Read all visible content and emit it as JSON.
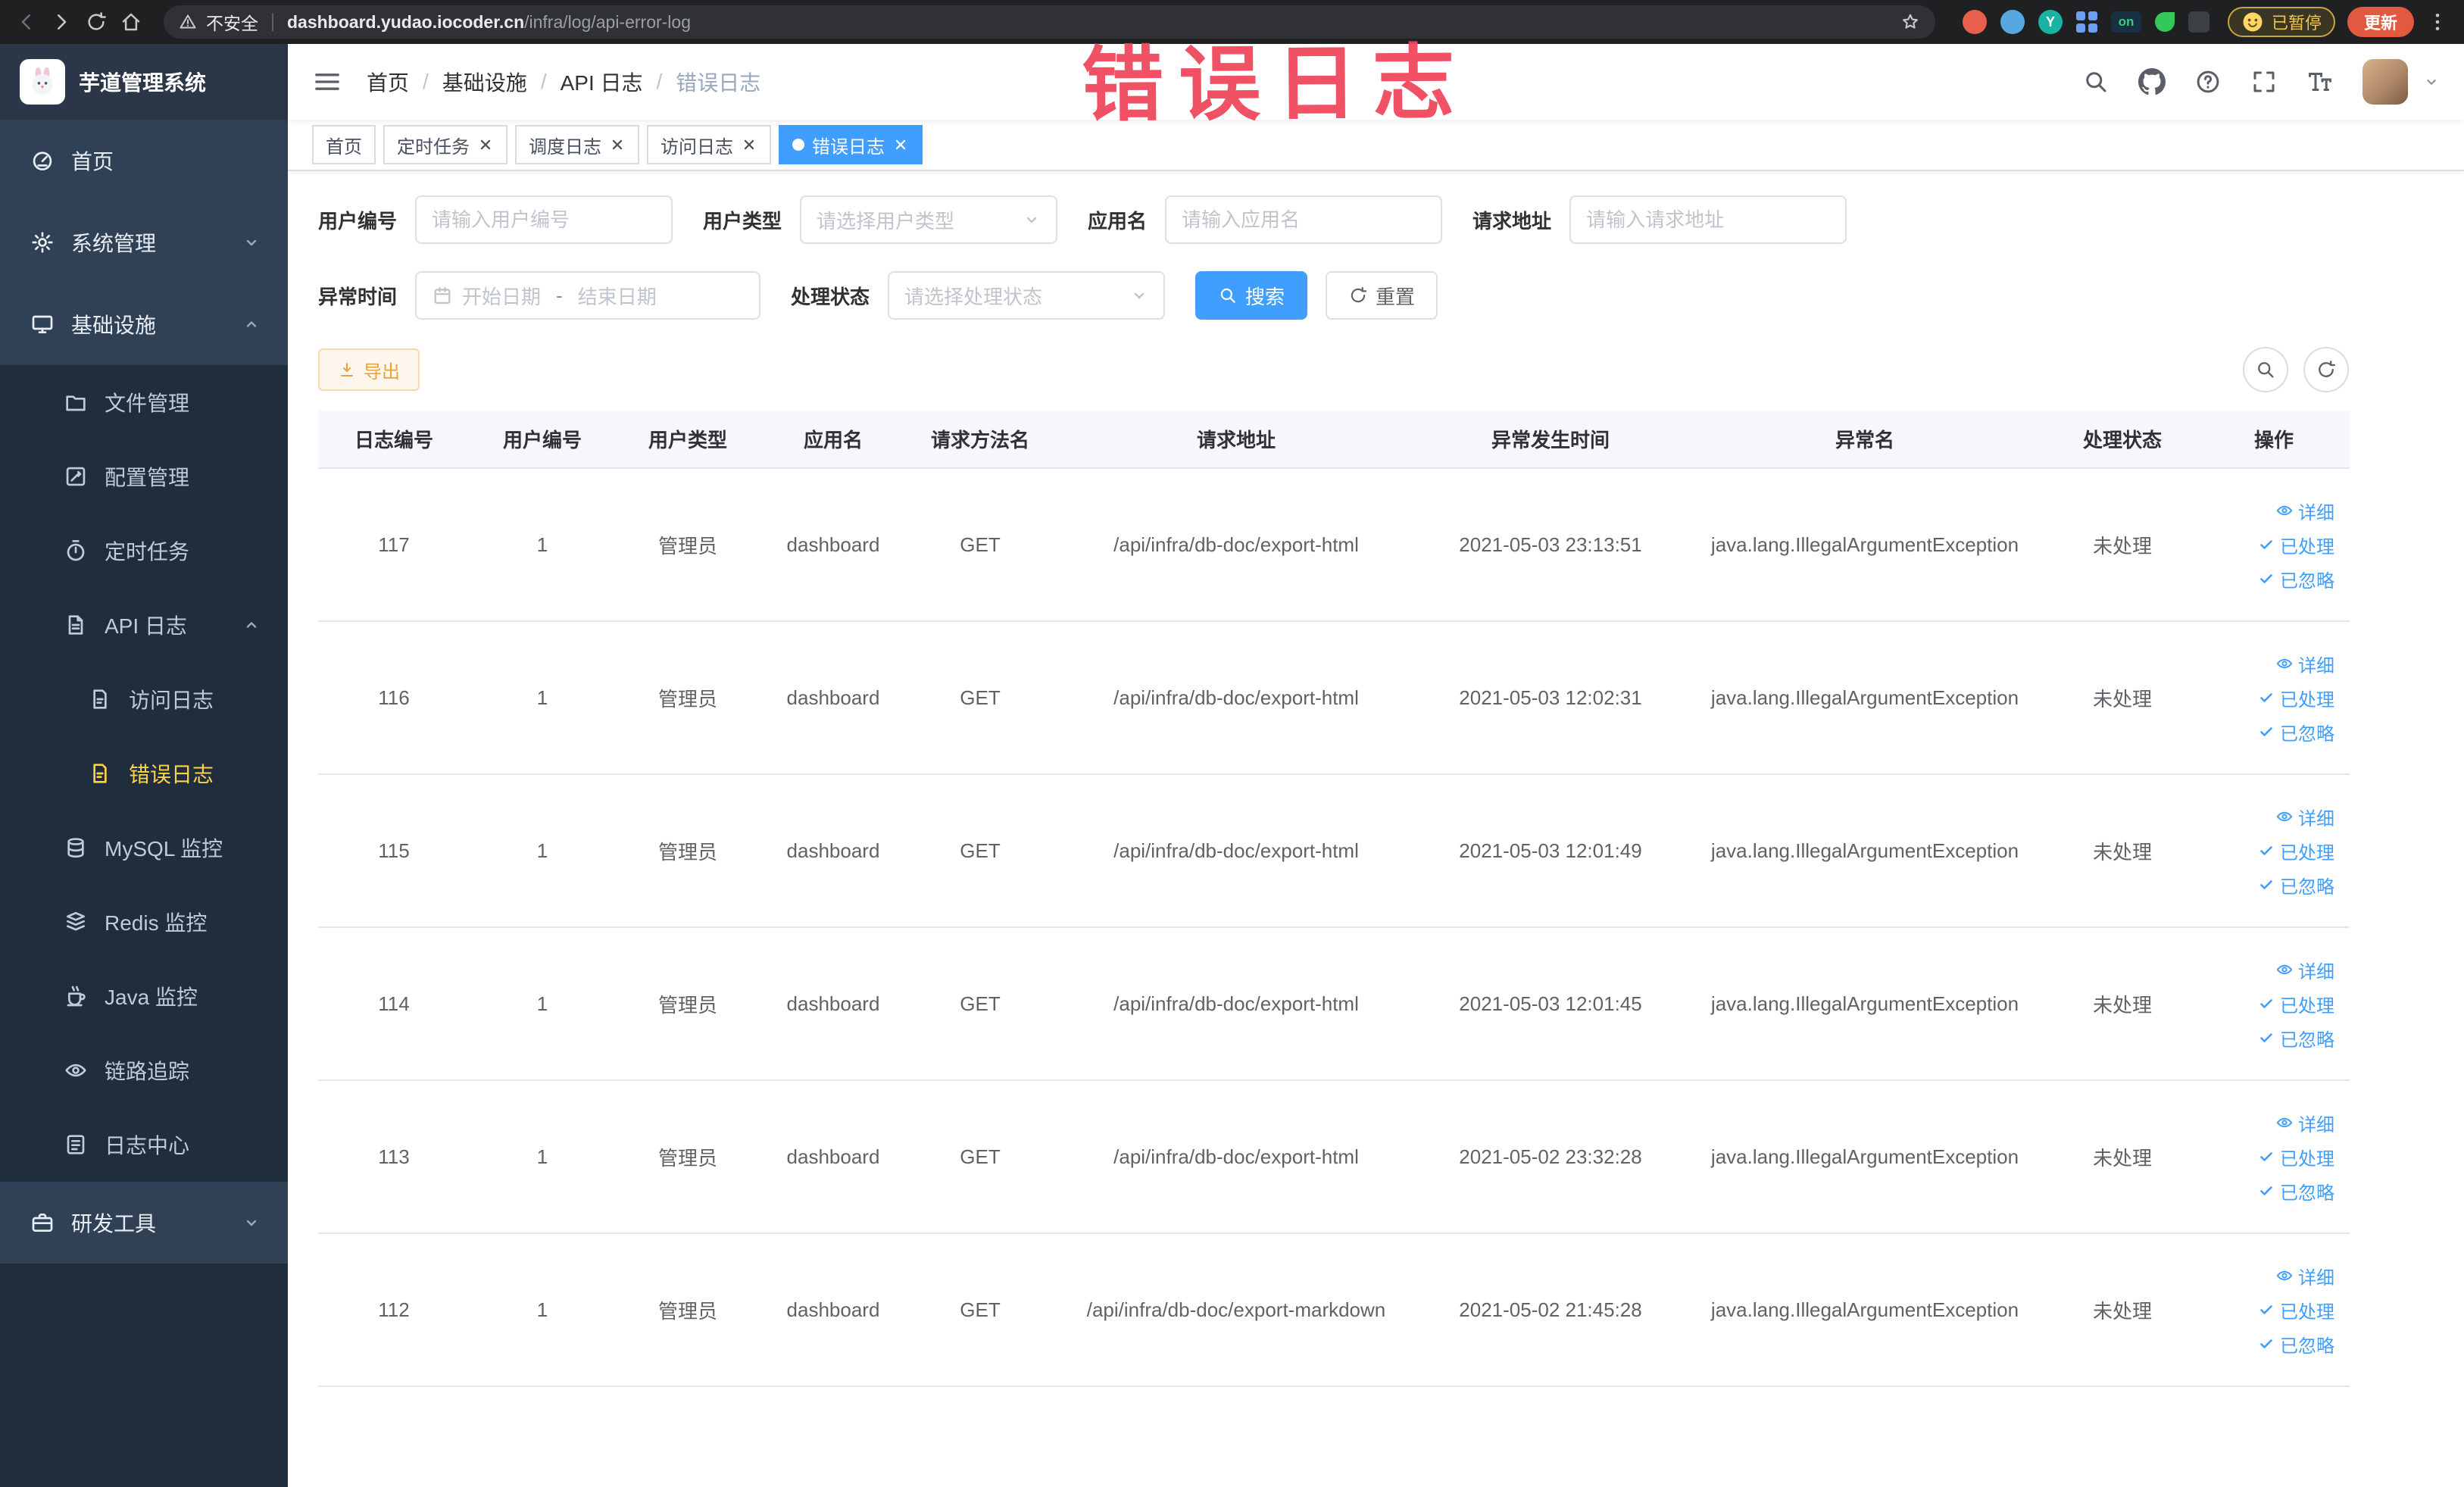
{
  "colors": {
    "accent": "#409EFF",
    "sidebar_bg": "#304156",
    "submenu_bg": "#1f2d3d",
    "active_text": "#ffd04b",
    "warning": "#e6a23c",
    "annotation_color": "#ef445a"
  },
  "annotation": "错误日志",
  "browser": {
    "security_label": "不安全",
    "url_host": "dashboard.yudao.iocoder.cn",
    "url_path": "/infra/log/api-error-log",
    "extension_y_label": "Y",
    "extension_on_label": "on",
    "paused_badge": "已暂停",
    "update_button": "更新"
  },
  "sidebar": {
    "logo_title": "芋道管理系统",
    "items": [
      {
        "name": "home",
        "label": "首页",
        "icon": "dashboard",
        "level": 1
      },
      {
        "name": "system",
        "label": "系统管理",
        "icon": "gear",
        "level": 1,
        "arrow": "down"
      },
      {
        "name": "infra",
        "label": "基础设施",
        "icon": "monitor",
        "level": 1,
        "arrow": "up"
      },
      {
        "name": "file",
        "label": "文件管理",
        "icon": "folder",
        "level": 2
      },
      {
        "name": "config",
        "label": "配置管理",
        "icon": "config",
        "level": 2
      },
      {
        "name": "job",
        "label": "定时任务",
        "icon": "timer",
        "level": 2
      },
      {
        "name": "api-log",
        "label": "API 日志",
        "icon": "apilog",
        "level": 2,
        "arrow": "up"
      },
      {
        "name": "access-log",
        "label": "访问日志",
        "icon": "doc",
        "level": 3
      },
      {
        "name": "error-log",
        "label": "错误日志",
        "icon": "doc",
        "level": 3,
        "active": true
      },
      {
        "name": "mysql",
        "label": "MySQL 监控",
        "icon": "mysql",
        "level": 2
      },
      {
        "name": "redis",
        "label": "Redis 监控",
        "icon": "redis",
        "level": 2
      },
      {
        "name": "java",
        "label": "Java 监控",
        "icon": "java",
        "level": 2
      },
      {
        "name": "trace",
        "label": "链路追踪",
        "icon": "eye",
        "level": 2
      },
      {
        "name": "log-center",
        "label": "日志中心",
        "icon": "logcenter",
        "level": 2
      },
      {
        "name": "dev-tools",
        "label": "研发工具",
        "icon": "tools",
        "level": 1,
        "arrow": "down"
      }
    ]
  },
  "breadcrumb": [
    "首页",
    "基础设施",
    "API 日志",
    "错误日志"
  ],
  "tabs": [
    {
      "name": "home",
      "label": "首页",
      "closable": false,
      "active": false
    },
    {
      "name": "job",
      "label": "定时任务",
      "closable": true,
      "active": false
    },
    {
      "name": "job-log",
      "label": "调度日志",
      "closable": true,
      "active": false
    },
    {
      "name": "access-log",
      "label": "访问日志",
      "closable": true,
      "active": false
    },
    {
      "name": "error-log",
      "label": "错误日志",
      "closable": true,
      "active": true
    }
  ],
  "filters": {
    "user_id": {
      "label": "用户编号",
      "placeholder": "请输入用户编号"
    },
    "user_type": {
      "label": "用户类型",
      "placeholder": "请选择用户类型"
    },
    "app_name": {
      "label": "应用名",
      "placeholder": "请输入应用名"
    },
    "request_url": {
      "label": "请求地址",
      "placeholder": "请输入请求地址"
    },
    "exception_time": {
      "label": "异常时间",
      "start_placeholder": "开始日期",
      "separator": "-",
      "end_placeholder": "结束日期"
    },
    "process_status": {
      "label": "处理状态",
      "placeholder": "请选择处理状态"
    },
    "search_label": "搜索",
    "reset_label": "重置"
  },
  "toolbar": {
    "export_label": "导出"
  },
  "table": {
    "headers": [
      "日志编号",
      "用户编号",
      "用户类型",
      "应用名",
      "请求方法名",
      "请求地址",
      "异常发生时间",
      "异常名",
      "处理状态",
      "操作"
    ],
    "row_keys": [
      "id",
      "user_id",
      "user_type",
      "app_name",
      "method",
      "url",
      "time",
      "exception",
      "status"
    ],
    "rows": [
      {
        "id": "117",
        "user_id": "1",
        "user_type": "管理员",
        "app_name": "dashboard",
        "method": "GET",
        "url": "/api/infra/db-doc/export-html",
        "time": "2021-05-03 23:13:51",
        "exception": "java.lang.IllegalArgumentException",
        "status": "未处理"
      },
      {
        "id": "116",
        "user_id": "1",
        "user_type": "管理员",
        "app_name": "dashboard",
        "method": "GET",
        "url": "/api/infra/db-doc/export-html",
        "time": "2021-05-03 12:02:31",
        "exception": "java.lang.IllegalArgumentException",
        "status": "未处理"
      },
      {
        "id": "115",
        "user_id": "1",
        "user_type": "管理员",
        "app_name": "dashboard",
        "method": "GET",
        "url": "/api/infra/db-doc/export-html",
        "time": "2021-05-03 12:01:49",
        "exception": "java.lang.IllegalArgumentException",
        "status": "未处理"
      },
      {
        "id": "114",
        "user_id": "1",
        "user_type": "管理员",
        "app_name": "dashboard",
        "method": "GET",
        "url": "/api/infra/db-doc/export-html",
        "time": "2021-05-03 12:01:45",
        "exception": "java.lang.IllegalArgumentException",
        "status": "未处理"
      },
      {
        "id": "113",
        "user_id": "1",
        "user_type": "管理员",
        "app_name": "dashboard",
        "method": "GET",
        "url": "/api/infra/db-doc/export-html",
        "time": "2021-05-02 23:32:28",
        "exception": "java.lang.IllegalArgumentException",
        "status": "未处理"
      },
      {
        "id": "112",
        "user_id": "1",
        "user_type": "管理员",
        "app_name": "dashboard",
        "method": "GET",
        "url": "/api/infra/db-doc/export-markdown",
        "time": "2021-05-02 21:45:28",
        "exception": "java.lang.IllegalArgumentException",
        "status": "未处理"
      }
    ],
    "actions": [
      {
        "name": "detail",
        "label": "详细",
        "icon": "eye"
      },
      {
        "name": "processed",
        "label": "已处理",
        "icon": "check"
      },
      {
        "name": "ignored",
        "label": "已忽略",
        "icon": "check"
      }
    ]
  }
}
